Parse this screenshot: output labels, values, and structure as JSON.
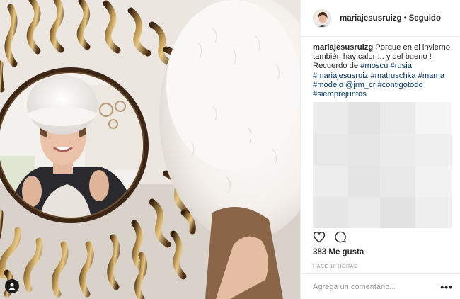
{
  "post": {
    "image_alt": "Foto de mariajesusruizg",
    "tagged_user_icon": "user-tag-icon"
  },
  "header": {
    "username": "mariajesusruizg",
    "separator": "•",
    "follow_status": "Seguido"
  },
  "caption": {
    "username": "mariajesusruizg",
    "text_1": "Porque en el invierno también hay calor ... y del bueno ! Recuerdo de",
    "tags": [
      "#moscu",
      "#rusia",
      "#mariajesusruiz",
      "#matruschka",
      "#mama",
      "#modelo",
      "@jrm_cr",
      "#contigotodo",
      "#siemprejuntos"
    ]
  },
  "actions": {
    "like_icon": "heart-icon",
    "comment_icon": "comment-icon"
  },
  "stats": {
    "likes": "383 Me gusta",
    "time_ago": "HACE 18 HORAS"
  },
  "comment": {
    "placeholder": "Agrega un comentario...",
    "more": "•••"
  },
  "colors": {
    "hashtag": "#003569",
    "muted": "#999999",
    "text": "#262626",
    "divider": "#efefef"
  }
}
